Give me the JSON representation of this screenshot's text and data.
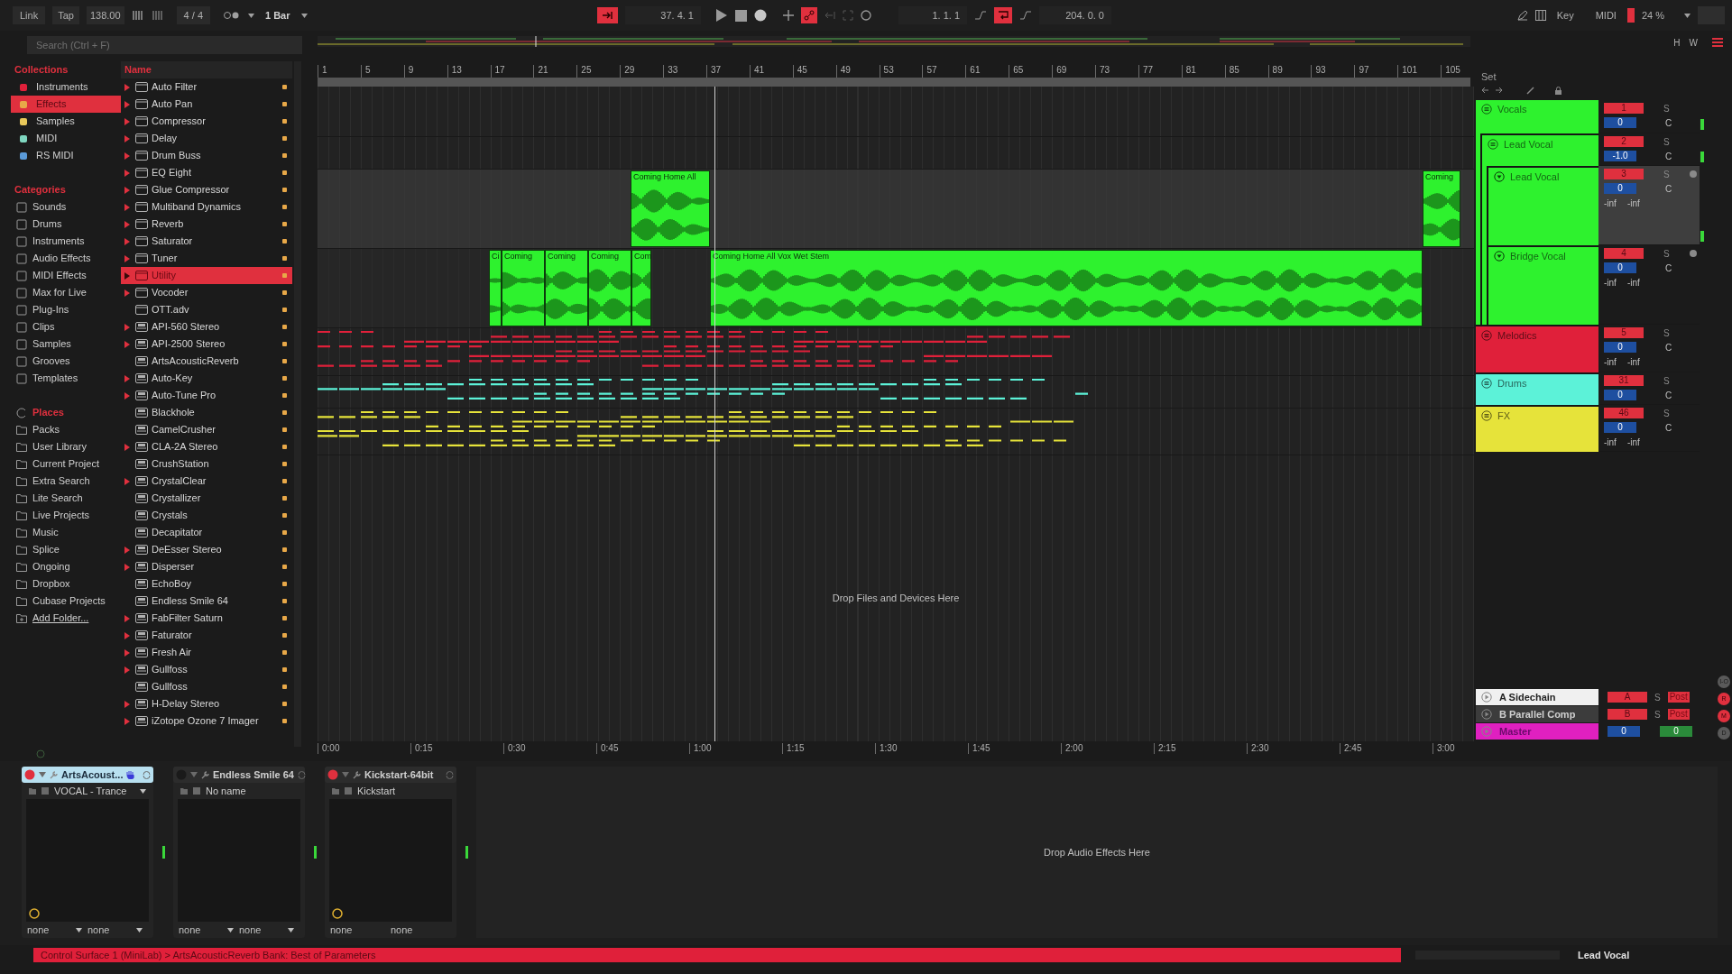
{
  "transport": {
    "link_button": "Link",
    "tap_button": "Tap",
    "tempo": "138.00",
    "time_signature": "4 / 4",
    "quantize": "1 Bar",
    "arrangement_record": true,
    "position": "37. 4. 1",
    "loop_start": "1. 1. 1",
    "loop": true,
    "loop_length": "204. 0. 0",
    "key_button": "Key",
    "midi_button": "MIDI",
    "cpu": "24 %",
    "h_button": "H",
    "w_button": "W"
  },
  "browser": {
    "search": {
      "placeholder": "Search (Ctrl + F)"
    },
    "collections": {
      "heading": "Collections",
      "items": [
        {
          "label": "Instruments",
          "color": "#e0203a",
          "selected": false
        },
        {
          "label": "Effects",
          "color": "#e8a848",
          "selected": true
        },
        {
          "label": "Samples",
          "color": "#e8c85a",
          "selected": false
        },
        {
          "label": "MIDI",
          "color": "#7fd6c0",
          "selected": false
        },
        {
          "label": "RS MIDI",
          "color": "#5a9ad8",
          "selected": false
        }
      ]
    },
    "categories": {
      "heading": "Categories",
      "items": [
        "Sounds",
        "Drums",
        "Instruments",
        "Audio Effects",
        "MIDI Effects",
        "Max for Live",
        "Plug-Ins",
        "Clips",
        "Samples",
        "Grooves",
        "Templates"
      ]
    },
    "places": {
      "heading": "Places",
      "items": [
        {
          "label": "Packs",
          "kind": "place"
        },
        {
          "label": "User Library",
          "kind": "place"
        },
        {
          "label": "Current Project",
          "kind": "place"
        },
        {
          "label": "Extra Search",
          "kind": "place"
        },
        {
          "label": "Lite Search",
          "kind": "place"
        },
        {
          "label": "Live Projects",
          "kind": "place"
        },
        {
          "label": "Music",
          "kind": "place"
        },
        {
          "label": "Splice",
          "kind": "place"
        },
        {
          "label": "Ongoing",
          "kind": "place"
        },
        {
          "label": "Dropbox",
          "kind": "place"
        },
        {
          "label": "Cubase Projects",
          "kind": "place"
        },
        {
          "label": "Add Folder...",
          "kind": "action"
        }
      ]
    },
    "name_column": "Name",
    "items": [
      {
        "label": "Auto Filter",
        "kind": "native",
        "expandable": true,
        "selected": false
      },
      {
        "label": "Auto Pan",
        "kind": "native",
        "expandable": true,
        "selected": false
      },
      {
        "label": "Compressor",
        "kind": "native",
        "expandable": true,
        "selected": false
      },
      {
        "label": "Delay",
        "kind": "native",
        "expandable": true,
        "selected": false
      },
      {
        "label": "Drum Buss",
        "kind": "native",
        "expandable": true,
        "selected": false
      },
      {
        "label": "EQ Eight",
        "kind": "native",
        "expandable": true,
        "selected": false
      },
      {
        "label": "Glue Compressor",
        "kind": "native",
        "expandable": true,
        "selected": false
      },
      {
        "label": "Multiband Dynamics",
        "kind": "native",
        "expandable": true,
        "selected": false
      },
      {
        "label": "Reverb",
        "kind": "native",
        "expandable": true,
        "selected": false
      },
      {
        "label": "Saturator",
        "kind": "native",
        "expandable": true,
        "selected": false
      },
      {
        "label": "Tuner",
        "kind": "native",
        "expandable": true,
        "selected": false
      },
      {
        "label": "Utility",
        "kind": "native",
        "expandable": true,
        "selected": true
      },
      {
        "label": "Vocoder",
        "kind": "native",
        "expandable": true,
        "selected": false
      },
      {
        "label": "OTT.adv",
        "kind": "native",
        "expandable": false,
        "selected": false
      },
      {
        "label": "API-560 Stereo",
        "kind": "plugin",
        "expandable": true,
        "selected": false
      },
      {
        "label": "API-2500 Stereo",
        "kind": "plugin",
        "expandable": true,
        "selected": false
      },
      {
        "label": "ArtsAcousticReverb",
        "kind": "plugin",
        "expandable": false,
        "selected": false
      },
      {
        "label": "Auto-Key",
        "kind": "plugin",
        "expandable": true,
        "selected": false
      },
      {
        "label": "Auto-Tune Pro",
        "kind": "plugin",
        "expandable": true,
        "selected": false
      },
      {
        "label": "Blackhole",
        "kind": "plugin",
        "expandable": false,
        "selected": false
      },
      {
        "label": "CamelCrusher",
        "kind": "plugin",
        "expandable": false,
        "selected": false
      },
      {
        "label": "CLA-2A Stereo",
        "kind": "plugin",
        "expandable": true,
        "selected": false
      },
      {
        "label": "CrushStation",
        "kind": "plugin",
        "expandable": false,
        "selected": false
      },
      {
        "label": "CrystalClear",
        "kind": "plugin",
        "expandable": true,
        "selected": false
      },
      {
        "label": "Crystallizer",
        "kind": "plugin",
        "expandable": false,
        "selected": false
      },
      {
        "label": "Crystals",
        "kind": "plugin",
        "expandable": false,
        "selected": false
      },
      {
        "label": "Decapitator",
        "kind": "plugin",
        "expandable": false,
        "selected": false
      },
      {
        "label": "DeEsser Stereo",
        "kind": "plugin",
        "expandable": true,
        "selected": false
      },
      {
        "label": "Disperser",
        "kind": "plugin",
        "expandable": true,
        "selected": false
      },
      {
        "label": "EchoBoy",
        "kind": "plugin",
        "expandable": false,
        "selected": false
      },
      {
        "label": "Endless Smile 64",
        "kind": "plugin",
        "expandable": false,
        "selected": false
      },
      {
        "label": "FabFilter Saturn",
        "kind": "plugin",
        "expandable": true,
        "selected": false
      },
      {
        "label": "Faturator",
        "kind": "plugin",
        "expandable": true,
        "selected": false
      },
      {
        "label": "Fresh Air",
        "kind": "plugin",
        "expandable": true,
        "selected": false
      },
      {
        "label": "Gullfoss",
        "kind": "plugin",
        "expandable": true,
        "selected": false
      },
      {
        "label": "Gullfoss",
        "kind": "plugin",
        "expandable": false,
        "selected": false
      },
      {
        "label": "H-Delay Stereo",
        "kind": "plugin",
        "expandable": true,
        "selected": false
      },
      {
        "label": "iZotope Ozone 7 Imager",
        "kind": "plugin",
        "expandable": true,
        "selected": false
      }
    ]
  },
  "arrangement": {
    "bar_numbers": [
      "1",
      "5",
      "9",
      "13",
      "17",
      "21",
      "25",
      "29",
      "33",
      "37",
      "41",
      "45",
      "49",
      "53",
      "57",
      "61",
      "65",
      "69",
      "73",
      "77",
      "81",
      "85",
      "89",
      "93",
      "97",
      "101",
      "105"
    ],
    "set_label": "Set",
    "tracks": [
      {
        "name": "Vocals",
        "kind": "group",
        "color": "#2ef22e",
        "number": "1",
        "pan": "0",
        "solo": "S",
        "center": "C",
        "selected": false,
        "children": [
          {
            "name": "Lead Vocal",
            "kind": "group",
            "color": "#2ef22e",
            "number": "2",
            "pan": "-1.0",
            "solo": "S",
            "center": "C",
            "selected": false,
            "children": [
              {
                "name": "Lead Vocal",
                "kind": "audio",
                "color": "#2ef22e",
                "number": "3",
                "pan": "0",
                "solo": "S",
                "center": "C",
                "readouts": [
                  "-inf",
                  "-inf"
                ],
                "selected": true,
                "clips": [
                  {
                    "name": "Coming Home All"
                  },
                  {
                    "name": "Coming"
                  }
                ]
              },
              {
                "name": "Bridge Vocal",
                "kind": "audio",
                "color": "#2ef22e",
                "number": "4",
                "pan": "0",
                "solo": "S",
                "center": "C",
                "readouts": [
                  "-inf",
                  "-inf"
                ],
                "selected": false,
                "clips": [
                  {
                    "name": "Ci"
                  },
                  {
                    "name": "Coming"
                  },
                  {
                    "name": "Coming"
                  },
                  {
                    "name": "Coming"
                  },
                  {
                    "name": "Com"
                  },
                  {
                    "name": "Coming Home All Vox Wet Stem"
                  }
                ]
              }
            ]
          }
        ]
      },
      {
        "name": "Melodics",
        "kind": "folded",
        "color": "#e0203a",
        "number": "5",
        "pan": "0",
        "solo": "S",
        "center": "C",
        "readouts": [
          "-inf",
          "-inf"
        ],
        "selected": false
      },
      {
        "name": "Drums",
        "kind": "folded",
        "color": "#5cf2d8",
        "number": "31",
        "pan": "0",
        "solo": "S",
        "center": "C",
        "selected": false
      },
      {
        "name": "FX",
        "kind": "folded",
        "color": "#e6e33a",
        "number": "46",
        "pan": "0",
        "solo": "S",
        "center": "C",
        "readouts": [
          "-inf",
          "-inf"
        ],
        "selected": false
      }
    ],
    "drop_hint": "Drop Files and Devices Here",
    "time_labels": [
      "0:00",
      "0:15",
      "0:30",
      "0:45",
      "1:00",
      "1:15",
      "1:30",
      "1:45",
      "2:00",
      "2:15",
      "2:30",
      "2:45",
      "3:00"
    ],
    "returns": [
      {
        "name": "A Sidechain",
        "kind": "return",
        "color": "#f0f0f0",
        "send": "A",
        "solo": "S",
        "route": "Post"
      },
      {
        "name": "B Parallel Comp",
        "kind": "return",
        "color": "#3c3c3c",
        "send": "B",
        "solo": "S",
        "route": "Post"
      },
      {
        "name": "Master",
        "kind": "master",
        "color": "#e020c0",
        "volume": "0",
        "pan": "0"
      }
    ],
    "view_buttons": [
      {
        "label": "I-O",
        "on": false
      },
      {
        "label": "R",
        "on": true
      },
      {
        "label": "M",
        "on": true
      },
      {
        "label": "D",
        "on": false
      }
    ]
  },
  "devices": [
    {
      "name": "ArtsAcoust...",
      "selected": true,
      "on": true,
      "mapped": true,
      "preset": "VOCAL - Trance",
      "preset_menu": true,
      "knob": true,
      "params": [
        "none",
        "none"
      ],
      "param_menus": true
    },
    {
      "name": "Endless Smile 64",
      "selected": false,
      "on": false,
      "mapped": false,
      "preset": "No name",
      "preset_menu": false,
      "knob": false,
      "params": [
        "none",
        "none"
      ],
      "param_menus": true
    },
    {
      "name": "Kickstart-64bit",
      "selected": false,
      "on": true,
      "mapped": false,
      "preset": "Kickstart",
      "preset_menu": false,
      "knob": true,
      "params": [
        "none",
        "none"
      ],
      "param_menus": false
    }
  ],
  "device_drop_hint": "Drop Audio Effects Here",
  "status_bar": {
    "message": "Control Surface 1 (MiniLab) > ArtsAcousticReverb Bank: Best of Parameters",
    "selected_track": "Lead Vocal"
  }
}
